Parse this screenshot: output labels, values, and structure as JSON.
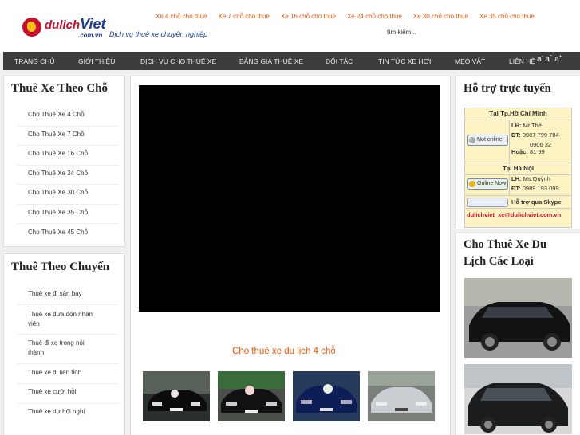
{
  "header": {
    "logo_text_1": "dulich",
    "logo_text_2": "Viet",
    "logo_sub": ".com.vn",
    "slogan": "Dịch vụ thuê xe chuyên nghiệp",
    "top_links": [
      "Xe 4 chỗ cho thuê",
      "Xe 7 chỗ cho thuê",
      "Xe 16 chỗ cho thuê",
      "Xe 24 chỗ cho thuê",
      "Xe 30 chỗ cho thuê",
      "Xe 35 chỗ cho thuê"
    ],
    "search_label": "tìm kiếm..."
  },
  "nav": {
    "items": [
      "TRANG CHỦ",
      "GIỚI THIỆU",
      "DỊCH VỤ CHO THUÊ XE",
      "BẢNG GIÁ THUÊ XE",
      "ĐỐI TÁC",
      "TIN TỨC XE HƠI",
      "MẸO VẶT",
      "LIÊN HỆ"
    ],
    "font_sizes": "a a a"
  },
  "left_seats": {
    "title": "Thuê Xe Theo Chỗ",
    "items": [
      "Cho Thuê Xe 4 Chỗ",
      "Cho Thuê Xe 7 Chỗ",
      "Cho Thuê Xe 16 Chỗ",
      "Cho Thuê Xe 24 Chỗ",
      "Cho Thuê Xe 30 Chỗ",
      "Cho Thuê Xe 35 Chỗ",
      "Cho Thuê Xe 45 Chỗ"
    ]
  },
  "left_trip": {
    "title": "Thuê Theo Chuyến",
    "items": [
      "Thuê xe đi sân bay",
      "Thuê xe đưa đón nhân viên",
      "Thuê đi xe trong nội thành",
      "Thuê xe đi liên tỉnh",
      "Thuê xe cưới hỏi",
      "Thuê xe dự hội nghị"
    ]
  },
  "main": {
    "section_title": "Cho thuê xe du lịch 4 chỗ"
  },
  "support": {
    "title": "Hỗ trợ trực tuyến",
    "hcm_title": "Tại Tp.Hồ Chí Minh",
    "hcm_status": "Not online",
    "hcm_lh": "LH:",
    "hcm_name": "Mr.Thế",
    "hcm_dt": "ĐT:",
    "hcm_phone": "0987 799 784",
    "hcm_or": "Hoặc:",
    "hcm_phone2": "0906 32 81 99",
    "hn_title": "Tại Hà Nội",
    "hn_status": "Online Now",
    "hn_lh": "LH:",
    "hn_name": "Ms.Quỳnh",
    "hn_dt": "ĐT:",
    "hn_phone": "0989 193 099",
    "skype_label": "Hỗ trợ qua Skype",
    "email": "dulichviet_xe@dulichviet.com.vn"
  },
  "right_cars": {
    "title": "Cho Thuê Xe Du Lịch Các Loại"
  }
}
